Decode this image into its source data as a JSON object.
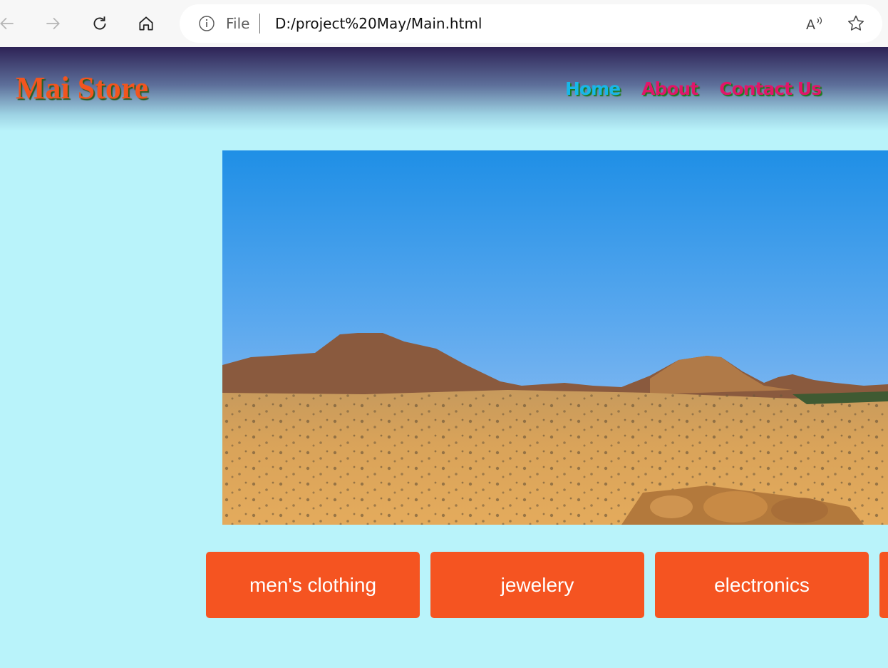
{
  "browser": {
    "address_prefix": "File",
    "url": "D:/project%20May/Main.html",
    "icons": [
      "back-arrow-icon",
      "forward-arrow-icon",
      "refresh-icon",
      "home-icon",
      "info-icon",
      "read-aloud-icon",
      "favorite-star-icon"
    ]
  },
  "header": {
    "brand": "Mai Store",
    "nav": [
      {
        "label": "Home"
      },
      {
        "label": "About"
      },
      {
        "label": "Contact Us"
      }
    ]
  },
  "categories": [
    {
      "label": "men's clothing"
    },
    {
      "label": "jewelery"
    },
    {
      "label": "electronics"
    },
    {
      "label": ""
    }
  ],
  "colors": {
    "page_background": "#b9f3fa",
    "brand": "#f2551f",
    "nav_home": "#18b7e8",
    "nav_links": "#e0166a",
    "category_button": "#f55421"
  }
}
